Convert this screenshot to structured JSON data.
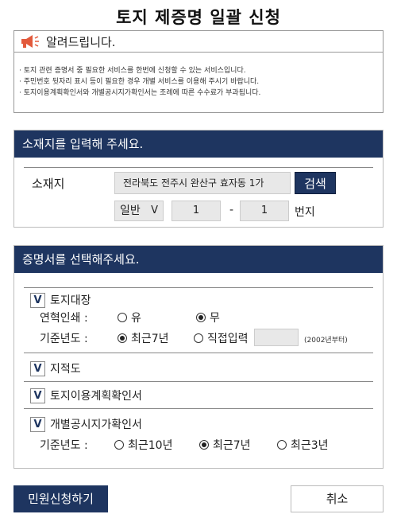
{
  "page": {
    "title": "토지 제증명 일괄 신청"
  },
  "notice": {
    "header": "알려드립니다.",
    "lines": [
      "· 토지 관련 증명서 중 필요한 서비스를 한번에 신청할 수 있는 서비스입니다.",
      "· 주민번호 뒷자리 표시 등이 필요한 경우 개별 서비스를 이용해 주시기 바랍니다.",
      "· 토지이용계획확인서와 개별공시지가확인서는 조례에 따른 수수료가 부과됩니다."
    ]
  },
  "location": {
    "header": "소재지를 입력해 주세요.",
    "label": "소재지",
    "address": "전라북도 전주시 완산구 효자동 1가",
    "search_label": "검색",
    "type_select": "일반",
    "type_arrow": "V",
    "main_number": "1",
    "dash": "-",
    "sub_number": "1",
    "unit": "번지"
  },
  "certificates": {
    "header": "증명서를 선택해주세요.",
    "check_mark": "V",
    "land_ledger": {
      "label": "토지대장",
      "checked": true,
      "history_label": "연혁인쇄 :",
      "history_yes": "유",
      "history_no": "무",
      "history_selected": "무",
      "year_label": "기준년도 :",
      "year_recent7": "최근7년",
      "year_direct": "직접입력",
      "year_selected": "최근7년",
      "year_note": "(2002년부터)"
    },
    "cadastral_map": {
      "label": "지적도",
      "checked": true
    },
    "land_use_plan": {
      "label": "토지이용계획확인서",
      "checked": true
    },
    "land_price": {
      "label": "개별공시지가확인서",
      "checked": true,
      "year_label": "기준년도 :",
      "opt_10": "최근10년",
      "opt_7": "최근7년",
      "opt_3": "최근3년",
      "selected": "최근7년"
    }
  },
  "actions": {
    "apply_label": "민원신청하기",
    "cancel_label": "취소"
  },
  "colors": {
    "accent": "#1e3560",
    "input_bg": "#e8e8e8"
  },
  "icons": {
    "notice": "megaphone-icon",
    "check": "check-icon"
  }
}
